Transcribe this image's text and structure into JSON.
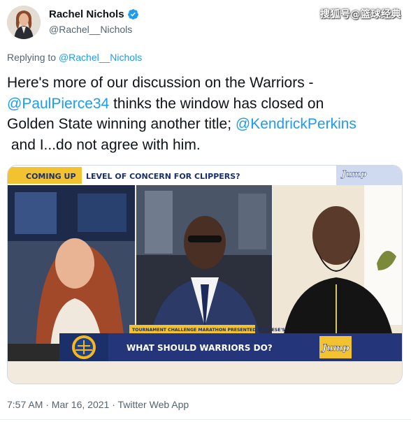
{
  "tweet": {
    "display_name": "Rachel Nichols",
    "handle": "@Rachel__Nichols",
    "replying_prefix": "Replying to",
    "replying_to": "@Rachel__Nichols",
    "text_line1": "Here's more of our discussion on the Warriors -",
    "mention_pierce": "@PaulPierce34",
    "text_line2_rest": " thinks the window has closed on",
    "text_line3": "Golden State winning another title; ",
    "mention_perkins": "@KendrickPerkins",
    "text_line4": " and I...do not agree with him.",
    "timestamp": "7:57 AM · Mar 16, 2021 · Twitter Web App"
  },
  "watermark": "搜狐号@篮球经典",
  "video": {
    "coming_up": "COMING UP",
    "topic": "LEVEL OF CONCERN FOR CLIPPERS?",
    "show_logo": "Jump",
    "sponsor_line": "TOURNAMENT CHALLENGE MARATHON PRESENTED BY REESE'S",
    "question": "WHAT SHOULD WARRIORS DO?",
    "colors": {
      "banner_bg": "#f2c230",
      "banner_blue": "#1b2f6b",
      "lower_third": "#24357a",
      "warriors_gold": "#f5b71b"
    }
  },
  "icons": {
    "verified": "verified-badge-icon",
    "avatar": "profile-avatar"
  }
}
